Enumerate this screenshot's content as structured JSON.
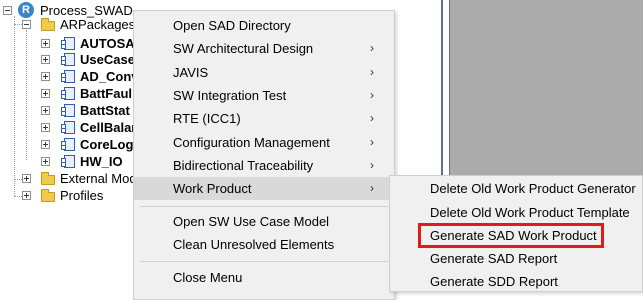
{
  "tree": {
    "root": "Process_SWAD",
    "arpackages": "ARPackages",
    "packages": [
      "AUTOSA",
      "UseCase",
      "AD_Conv",
      "BattFaul",
      "BattStat",
      "CellBalar",
      "CoreLog",
      "HW_IO"
    ],
    "external": "External Mod",
    "profiles": "Profiles"
  },
  "menu": {
    "items": [
      {
        "label": "Open SAD Directory"
      },
      {
        "label": "SW Architectural Design"
      },
      {
        "label": "JAVIS"
      },
      {
        "label": "SW Integration Test"
      },
      {
        "label": "RTE (ICC1)"
      },
      {
        "label": "Configuration Management"
      },
      {
        "label": "Bidirectional Traceability"
      },
      {
        "label": "Work Product"
      },
      {
        "label": "Open SW Use Case Model"
      },
      {
        "label": "Clean Unresolved Elements"
      },
      {
        "label": "Close Menu"
      }
    ],
    "arrow": "›"
  },
  "submenu": {
    "items": [
      {
        "label": "Delete Old Work Product Generator"
      },
      {
        "label": "Delete Old Work Product Template"
      },
      {
        "label": "Generate SAD Work Product"
      },
      {
        "label": "Generate SAD Report"
      },
      {
        "label": "Generate SDD Report"
      }
    ]
  },
  "colors": {
    "highlight_box": "#e01b1b",
    "menu_bg": "#f0f0f0",
    "hover_bg": "#d9d9d9"
  }
}
